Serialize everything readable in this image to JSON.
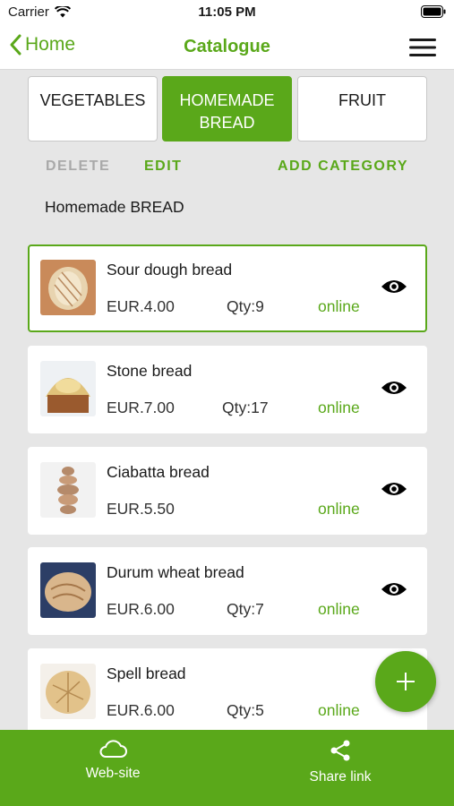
{
  "status_bar": {
    "carrier": "Carrier",
    "time": "11:05 PM"
  },
  "nav": {
    "back_label": "Home",
    "title": "Catalogue"
  },
  "tabs": [
    {
      "label": "VEGETABLES",
      "active": false
    },
    {
      "label": "HOMEMADE BREAD",
      "active": true
    },
    {
      "label": "FRUIT",
      "active": false
    }
  ],
  "actions": {
    "delete": "DELETE",
    "edit": "EDIT",
    "add_category": "ADD CATEGORY"
  },
  "section_title": "Homemade BREAD",
  "products": [
    {
      "name": "Sour dough bread",
      "price": "EUR.4.00",
      "qty": "Qty:9",
      "status": "online",
      "selected": true
    },
    {
      "name": "Stone bread",
      "price": "EUR.7.00",
      "qty": "Qty:17",
      "status": "online"
    },
    {
      "name": "Ciabatta bread",
      "price": "EUR.5.50",
      "qty": "",
      "status": "online"
    },
    {
      "name": "Durum wheat bread",
      "price": "EUR.6.00",
      "qty": "Qty:7",
      "status": "online"
    },
    {
      "name": "Spell bread",
      "price": "EUR.6.00",
      "qty": "Qty:5",
      "status": "online"
    }
  ],
  "bottom_bar": {
    "website_label": "Web-site",
    "share_label": "Share link"
  },
  "colors": {
    "accent": "#5aa81a",
    "background": "#e6e6e6",
    "card": "#ffffff",
    "muted": "#a9a9a9"
  },
  "icons": {
    "wifi": "wifi-icon",
    "battery": "battery-icon",
    "back": "chevron-left-icon",
    "menu": "hamburger-menu-icon",
    "view": "eye-icon",
    "add": "plus-icon",
    "website": "cloud-icon",
    "share": "share-icon"
  }
}
